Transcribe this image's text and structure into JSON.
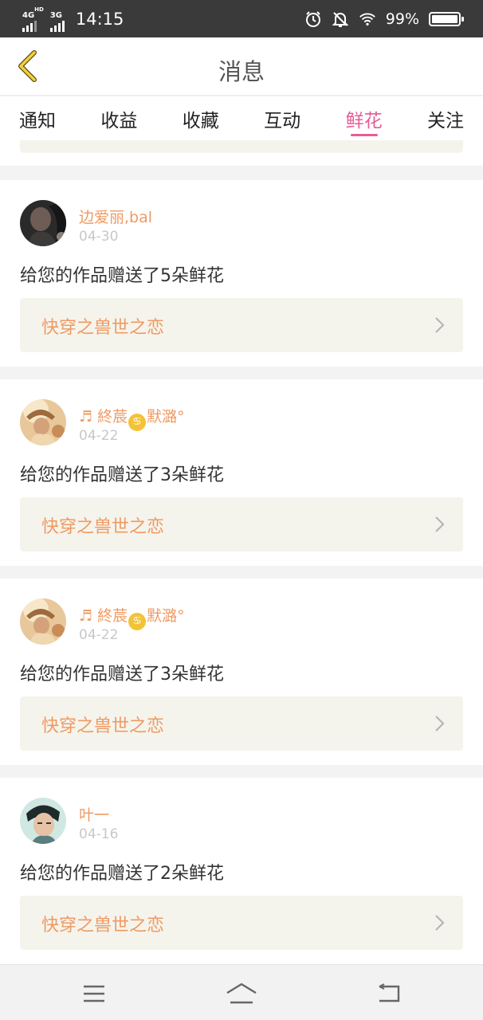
{
  "status_bar": {
    "net1": "4G",
    "net1_sup": "HD",
    "net2": "3G",
    "time": "14:15",
    "battery": "99%",
    "battery_level": 0.99,
    "icons": [
      "alarm-icon",
      "bell-off-icon",
      "wifi-icon",
      "battery-icon"
    ]
  },
  "header": {
    "title": "消息",
    "back_icon": "chevron-left-icon"
  },
  "tabs": [
    {
      "label": "通知",
      "active": false
    },
    {
      "label": "收益",
      "active": false
    },
    {
      "label": "收藏",
      "active": false
    },
    {
      "label": "互动",
      "active": false
    },
    {
      "label": "鲜花",
      "active": true
    },
    {
      "label": "关注",
      "active": false
    }
  ],
  "colors": {
    "accent": "#e85b95",
    "name": "#ef9a63",
    "card_box": "#f5f4ec"
  },
  "messages": [
    {
      "name": "边爱丽,bal",
      "date": "04-30",
      "text": "给您的作品赠送了5朵鲜花",
      "work": "快穿之兽世之恋"
    },
    {
      "name_prefix": "♬ 終莀",
      "name_badge": "♋",
      "name_suffix": "默潞°",
      "date": "04-22",
      "text": "给您的作品赠送了3朵鲜花",
      "work": "快穿之兽世之恋"
    },
    {
      "name_prefix": "♬ 終莀",
      "name_badge": "♋",
      "name_suffix": "默潞°",
      "date": "04-22",
      "text": "给您的作品赠送了3朵鲜花",
      "work": "快穿之兽世之恋"
    },
    {
      "name": "叶一",
      "date": "04-16",
      "text": "给您的作品赠送了2朵鲜花",
      "work": "快穿之兽世之恋"
    }
  ],
  "navbar": [
    "menu-icon",
    "home-icon",
    "back-icon"
  ]
}
